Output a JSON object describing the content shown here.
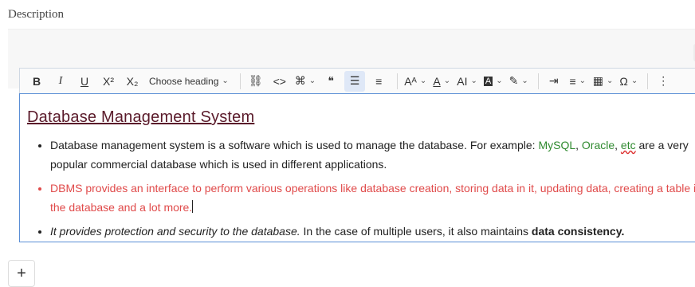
{
  "label": "Description",
  "toolbar": {
    "bold": "B",
    "italic": "I",
    "underline": "U",
    "superscript": "X²",
    "subscript": "X₂",
    "heading": "Choose heading",
    "link": "⛓",
    "code": "<>",
    "insert": "⌘",
    "quote": "❝",
    "bullet_list": "☰",
    "numbered_list": "≡",
    "font_size": "Aᴬ",
    "font_color": "A",
    "ai": "AI",
    "bg_color": "A",
    "highlight": "✎",
    "indent": "⇥",
    "align": "≡",
    "table": "▦",
    "special_chars": "Ω",
    "more": "⋮"
  },
  "doc": {
    "title": "Database Management System",
    "item1_a": "Database management system is a software which is used to manage the database. For example: ",
    "item1_mysql": "MySQL",
    "item1_sep": ", ",
    "item1_oracle": "Oracle",
    "item1_comma": ", ",
    "item1_etc": "etc",
    "item1_b": " are a very popular commercial database which is used in different applications.",
    "item2": "DBMS provides an interface to perform various operations like database creation, storing data in it, updating data, creating a table in the database and a lot more.",
    "item3_italic": "It provides protection and security to the database.",
    "item3_text": " In the case of multiple users, it also maintains ",
    "item3_bold": "data consistency."
  },
  "add_button": "+",
  "colors": {
    "accent": "#5b8fd6",
    "green": "#2f8a2f",
    "red": "#e04a4a",
    "title": "#5a1a2a"
  }
}
